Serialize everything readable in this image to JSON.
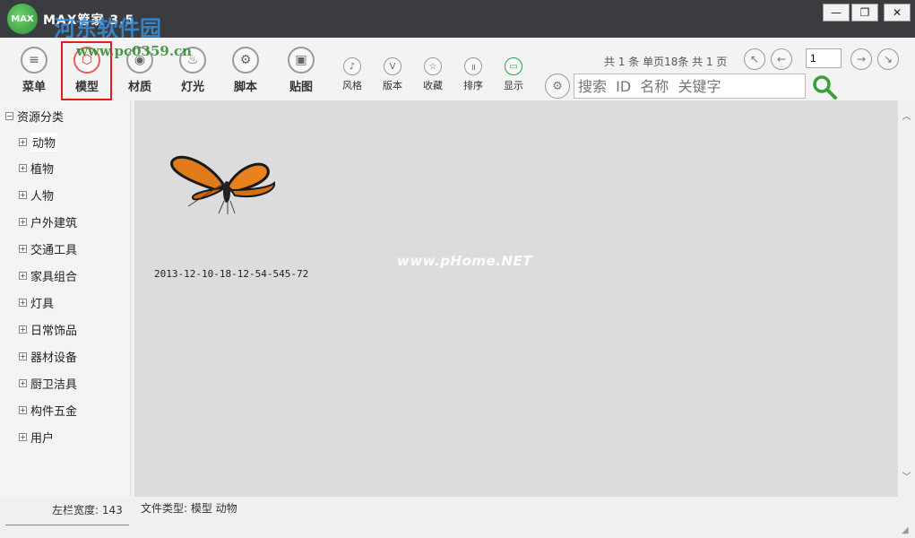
{
  "window": {
    "logo_text": "MAX",
    "title": "MAX管家 3.5",
    "watermark_site": "河东软件园",
    "watermark_url": "www.pc0359.cn",
    "minimize": "—",
    "maximize": "❐",
    "close": "✕"
  },
  "toolbar": {
    "menu": "菜单",
    "model": "模型",
    "material": "材质",
    "light": "灯光",
    "script": "脚本",
    "texture": "贴图",
    "style": "风格",
    "version": "版本",
    "favorite": "收藏",
    "sort": "排序",
    "display": "显示",
    "version_glyph": "V"
  },
  "paging": {
    "summary": "共 1 条 单页18条 共 1 页",
    "current_page": "1"
  },
  "search": {
    "placeholder": "搜索  ID  名称  关键字"
  },
  "tree": {
    "root": "资源分类",
    "items": [
      "动物",
      "植物",
      "人物",
      "户外建筑",
      "交通工具",
      "家具组合",
      "灯具",
      "日常饰品",
      "器材设备",
      "厨卫洁具",
      "构件五金",
      "用户"
    ]
  },
  "main": {
    "thumbnail_caption": "2013-12-10-18-12-54-545-72",
    "watermark": "www.pHome.NET"
  },
  "status": {
    "left_width": "左栏宽度: 143",
    "file_type": "文件类型: 模型    动物"
  },
  "colors": {
    "highlight": "#e02020",
    "titlebar": "#3a3c40",
    "display_icon": "#2aa24a"
  }
}
